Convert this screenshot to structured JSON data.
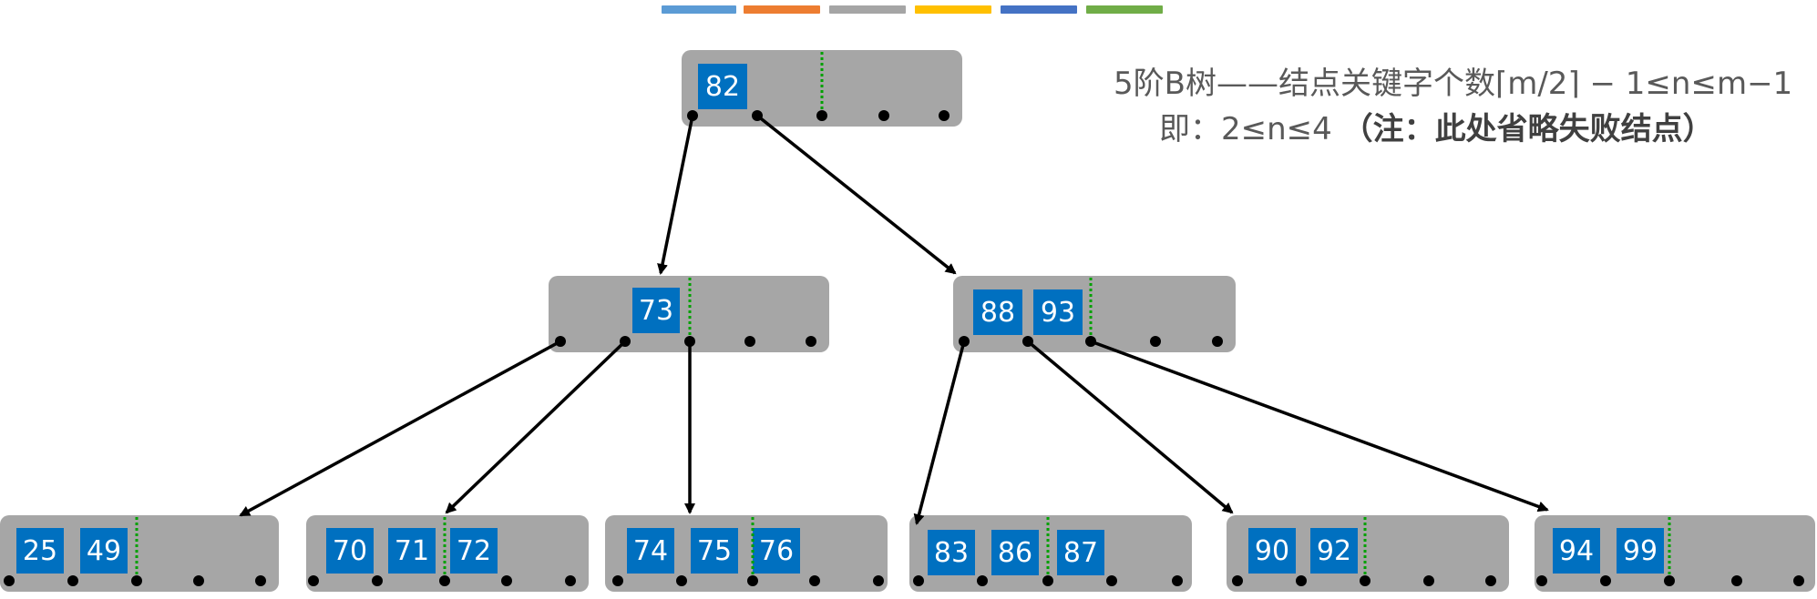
{
  "top_color_bars": [
    "#5b9bd5",
    "#ed7d31",
    "#a5a5a5",
    "#ffc000",
    "#4472c4",
    "#70ad47"
  ],
  "caption": {
    "line1": "5阶B树——结点关键字个数⌈m/2⌉ − 1≤n≤m−1",
    "line2_prefix": "即：2≤n≤4",
    "line2_bold": "（注：此处省略失败结点）"
  },
  "colors": {
    "node_fill": "#a6a6a6",
    "key_fill": "#0070c0",
    "key_text": "#ffffff",
    "separator": "#00a000",
    "edge": "#000000"
  },
  "tree": {
    "root": {
      "keys": [
        "82"
      ]
    },
    "level1": [
      {
        "keys": [
          "73"
        ]
      },
      {
        "keys": [
          "88",
          "93"
        ]
      }
    ],
    "leaves": [
      {
        "keys": [
          "25",
          "49"
        ]
      },
      {
        "keys": [
          "70",
          "71",
          "72"
        ]
      },
      {
        "keys": [
          "74",
          "75",
          "76"
        ]
      },
      {
        "keys": [
          "83",
          "86",
          "87"
        ]
      },
      {
        "keys": [
          "90",
          "92"
        ]
      },
      {
        "keys": [
          "94",
          "99"
        ]
      }
    ],
    "edges": [
      {
        "from": "root",
        "pointer": 0,
        "to": "level1.0"
      },
      {
        "from": "root",
        "pointer": 1,
        "to": "level1.1"
      },
      {
        "from": "level1.0",
        "pointer": 0,
        "to": "leaves.0"
      },
      {
        "from": "level1.0",
        "pointer": 1,
        "to": "leaves.1"
      },
      {
        "from": "level1.0",
        "pointer": 2,
        "to": "leaves.2"
      },
      {
        "from": "level1.1",
        "pointer": 0,
        "to": "leaves.3"
      },
      {
        "from": "level1.1",
        "pointer": 1,
        "to": "leaves.4"
      },
      {
        "from": "level1.1",
        "pointer": 2,
        "to": "leaves.5"
      }
    ]
  }
}
